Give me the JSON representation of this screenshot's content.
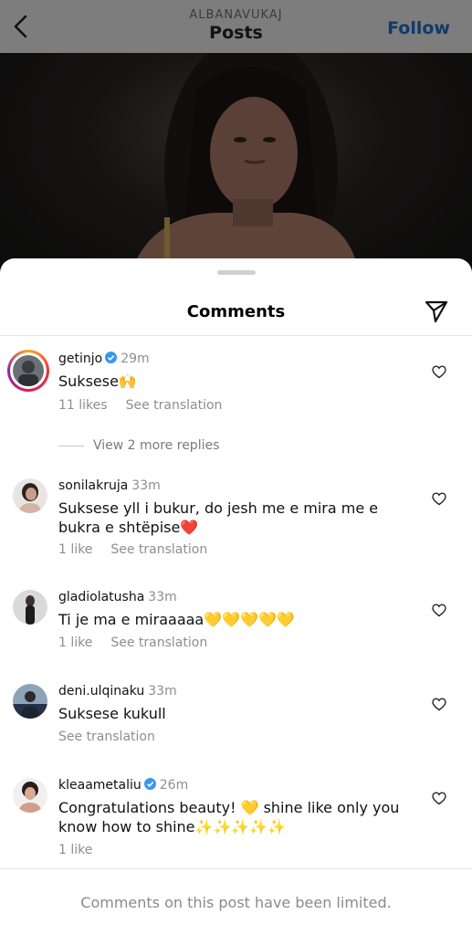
{
  "header": {
    "username": "ALBANAVUKAJ",
    "title": "Posts",
    "follow_label": "Follow"
  },
  "sheet": {
    "title": "Comments",
    "limited_notice": "Comments on this post have been limited."
  },
  "comments": [
    {
      "username": "getinjo",
      "verified": true,
      "time": "29m",
      "text": "Suksese🙌",
      "likes": "11 likes",
      "translation": "See translation",
      "view_replies": "View 2 more replies"
    },
    {
      "username": "sonilakruja",
      "time": "33m",
      "text": "Suksese yll i bukur, do jesh me e mira me e bukra e shtëpise❤️",
      "likes": "1 like",
      "translation": "See translation"
    },
    {
      "username": "gladiolatusha",
      "time": "33m",
      "text": "Ti je ma e miraaaaa💛💛💛💛💛",
      "likes": "1 like",
      "translation": "See translation"
    },
    {
      "username": "deni.ulqinaku",
      "time": "33m",
      "text": "Suksese kukull",
      "translation": "See translation"
    },
    {
      "username": "kleaametaliu",
      "verified": true,
      "time": "26m",
      "text": "Congratulations beauty! 💛 shine like only you know how to shine✨✨✨✨✨",
      "likes": "1 like"
    }
  ],
  "icons": {
    "back": "chevron-left-icon",
    "share": "paper-plane-icon",
    "like": "heart-outline-icon",
    "verified": "verified-badge-icon"
  },
  "colors": {
    "follow": "#123a69",
    "verified": "#3897f0",
    "secondary_text": "#8e8e8e"
  }
}
